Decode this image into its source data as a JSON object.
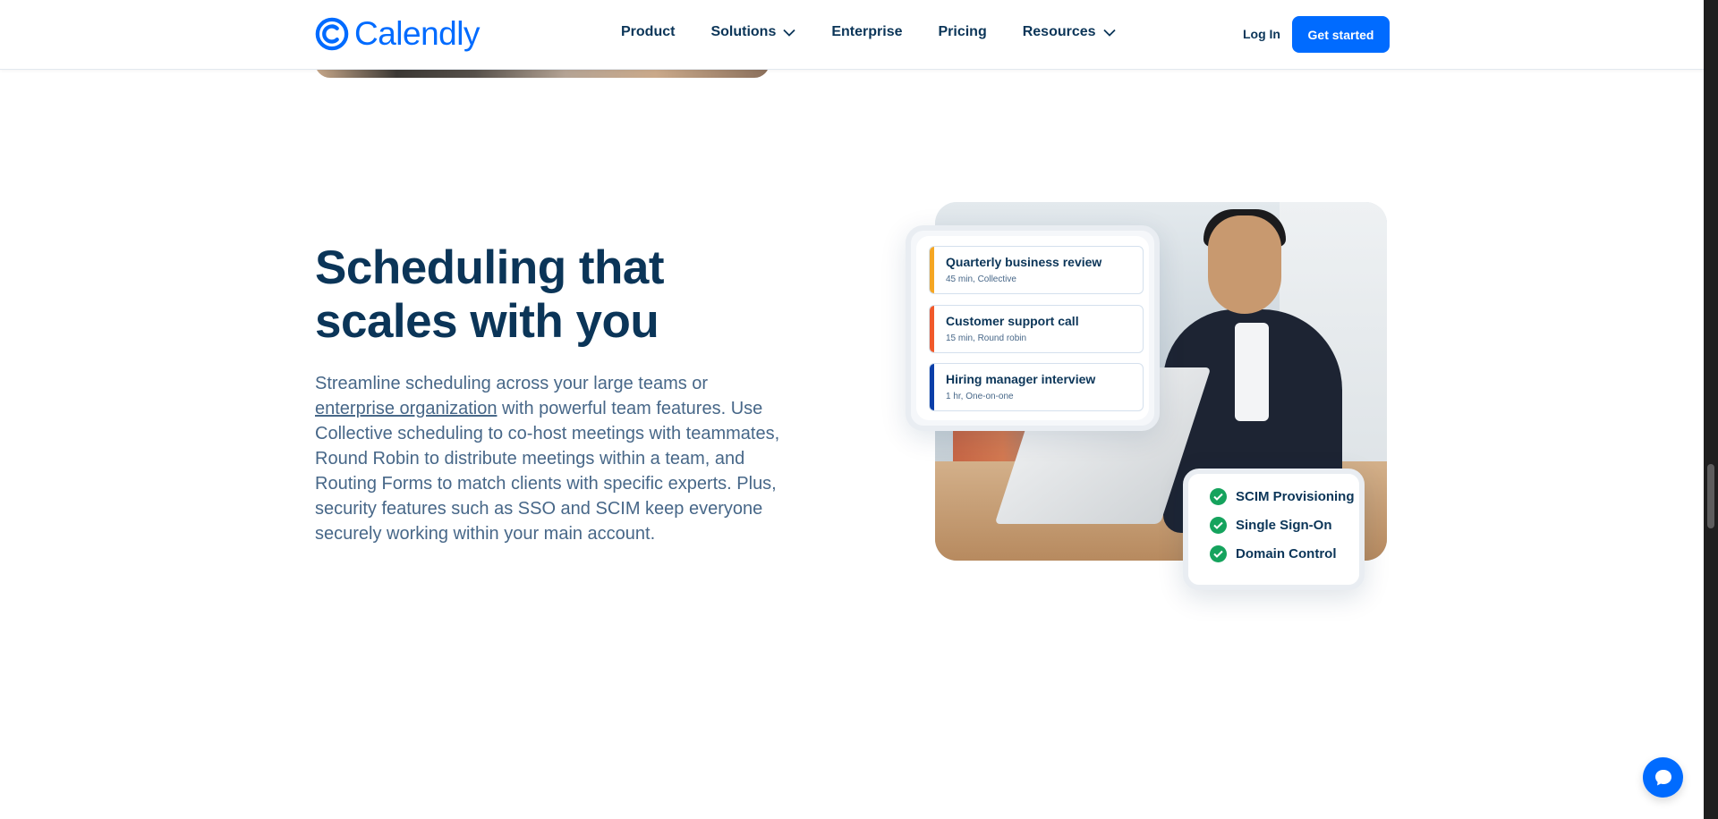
{
  "brand": {
    "name": "Calendly",
    "color": "#006bff",
    "text_color": "#0b3558"
  },
  "nav": {
    "items": [
      {
        "label": "Product",
        "has_dropdown": false
      },
      {
        "label": "Solutions",
        "has_dropdown": true
      },
      {
        "label": "Enterprise",
        "has_dropdown": false
      },
      {
        "label": "Pricing",
        "has_dropdown": false
      },
      {
        "label": "Resources",
        "has_dropdown": true
      }
    ],
    "login_label": "Log In",
    "cta_label": "Get started"
  },
  "section": {
    "heading_line1": "Scheduling that",
    "heading_line2": "scales with you",
    "body_before_link": "Streamline scheduling across your large teams or ",
    "body_link": "enterprise organization",
    "body_after_link": " with powerful team features. Use Collective scheduling to co-host meetings with teammates, Round Robin to distribute meetings within a team, and Routing Forms to match clients with specific experts. Plus, security features such as SSO and SCIM keep everyone securely working within your main account."
  },
  "event_card": {
    "events": [
      {
        "title": "Quarterly business review",
        "subtitle": "45 min, Collective",
        "color": "#f5a623"
      },
      {
        "title": "Customer support call",
        "subtitle": "15 min, Round robin",
        "color": "#f1592a"
      },
      {
        "title": "Hiring manager interview",
        "subtitle": "1 hr, One-on-one",
        "color": "#0b3ea8"
      }
    ]
  },
  "features_card": {
    "items": [
      {
        "label": "SCIM Provisioning"
      },
      {
        "label": "Single Sign-On"
      },
      {
        "label": "Domain Control"
      }
    ],
    "check_color": "#15a35d"
  },
  "icons": {
    "logo": "calendly-logo-icon",
    "chevron": "chevron-down-icon",
    "check": "check-circle-icon",
    "chat": "chat-bubble-icon"
  }
}
